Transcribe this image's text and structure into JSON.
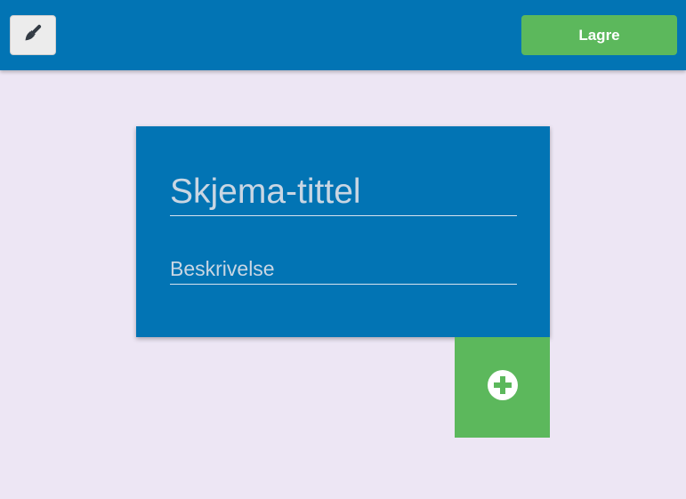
{
  "toolbar": {
    "theme_icon": "paintbrush-icon",
    "save_label": "Lagre"
  },
  "form": {
    "title_placeholder": "Skjema-tittel",
    "description_placeholder": "Beskrivelse"
  },
  "add_button": {
    "icon": "plus-circle-icon"
  },
  "colors": {
    "primary": "#0274b4",
    "success": "#5cb85c",
    "background": "#ede6f4"
  }
}
